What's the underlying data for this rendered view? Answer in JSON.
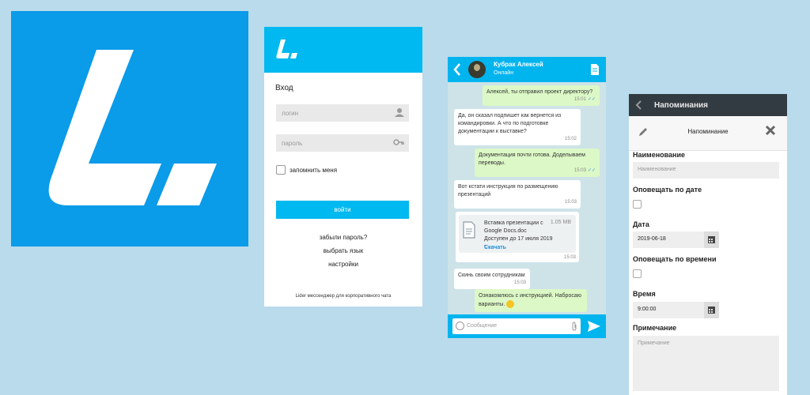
{
  "login": {
    "title": "Вход",
    "login_placeholder": "логин",
    "password_placeholder": "пароль",
    "remember": "запомнить меня",
    "submit": "войти",
    "forgot": "забыли пароль?",
    "language": "выбрать язык",
    "settings": "настройки",
    "footer": "Lider мессенджер для корпоративного чата"
  },
  "chat": {
    "name": "Кубрак  Алексей",
    "status": "Онлайн",
    "messages": [
      {
        "text": "Алексей, ты отправил проект директору?",
        "time": "15:01",
        "dir": "out"
      },
      {
        "text": "Да, он сказал подпишет как вернется из командировки. А что по подготовке документации к выставке?",
        "time": "15:02",
        "dir": "in"
      },
      {
        "text": "Документация почти готова. Доделываем переводы.",
        "time": "15:03",
        "dir": "out"
      },
      {
        "text": "Вот кстати инструкция по размещению презентаций",
        "time": "15:03",
        "dir": "in"
      },
      {
        "text": "Скинь своим сотрудникам",
        "time": "15:03",
        "dir": "in"
      },
      {
        "text": "Ознакомлюсь с инструкцией. Набросаю варианты.",
        "time": "",
        "dir": "out"
      }
    ],
    "file": {
      "name": "Вставка презентации с Google Docs.doc",
      "available": "Доступен до 17 июля 2019 г.",
      "size": "1.05 MB",
      "download": "Скачать",
      "time": "15:03"
    },
    "input_placeholder": "Сообщение"
  },
  "reminder": {
    "screen_title": "Напоминания",
    "modal_title": "Напоминание",
    "name_label": "Наименование",
    "name_placeholder": "Наименование",
    "notify_date_label": "Оповещать по дате",
    "date_label": "Дата",
    "date_value": "2019-06-18",
    "notify_time_label": "Оповещать по времени",
    "time_label": "Время",
    "time_value": "9:00:00",
    "note_label": "Примечание",
    "note_placeholder": "Примечание"
  },
  "colors": {
    "brand_blue": "#0a9be9",
    "header_blue": "#00b9f0",
    "dark_header": "#333b42",
    "out_bubble": "#dcf8c6"
  }
}
